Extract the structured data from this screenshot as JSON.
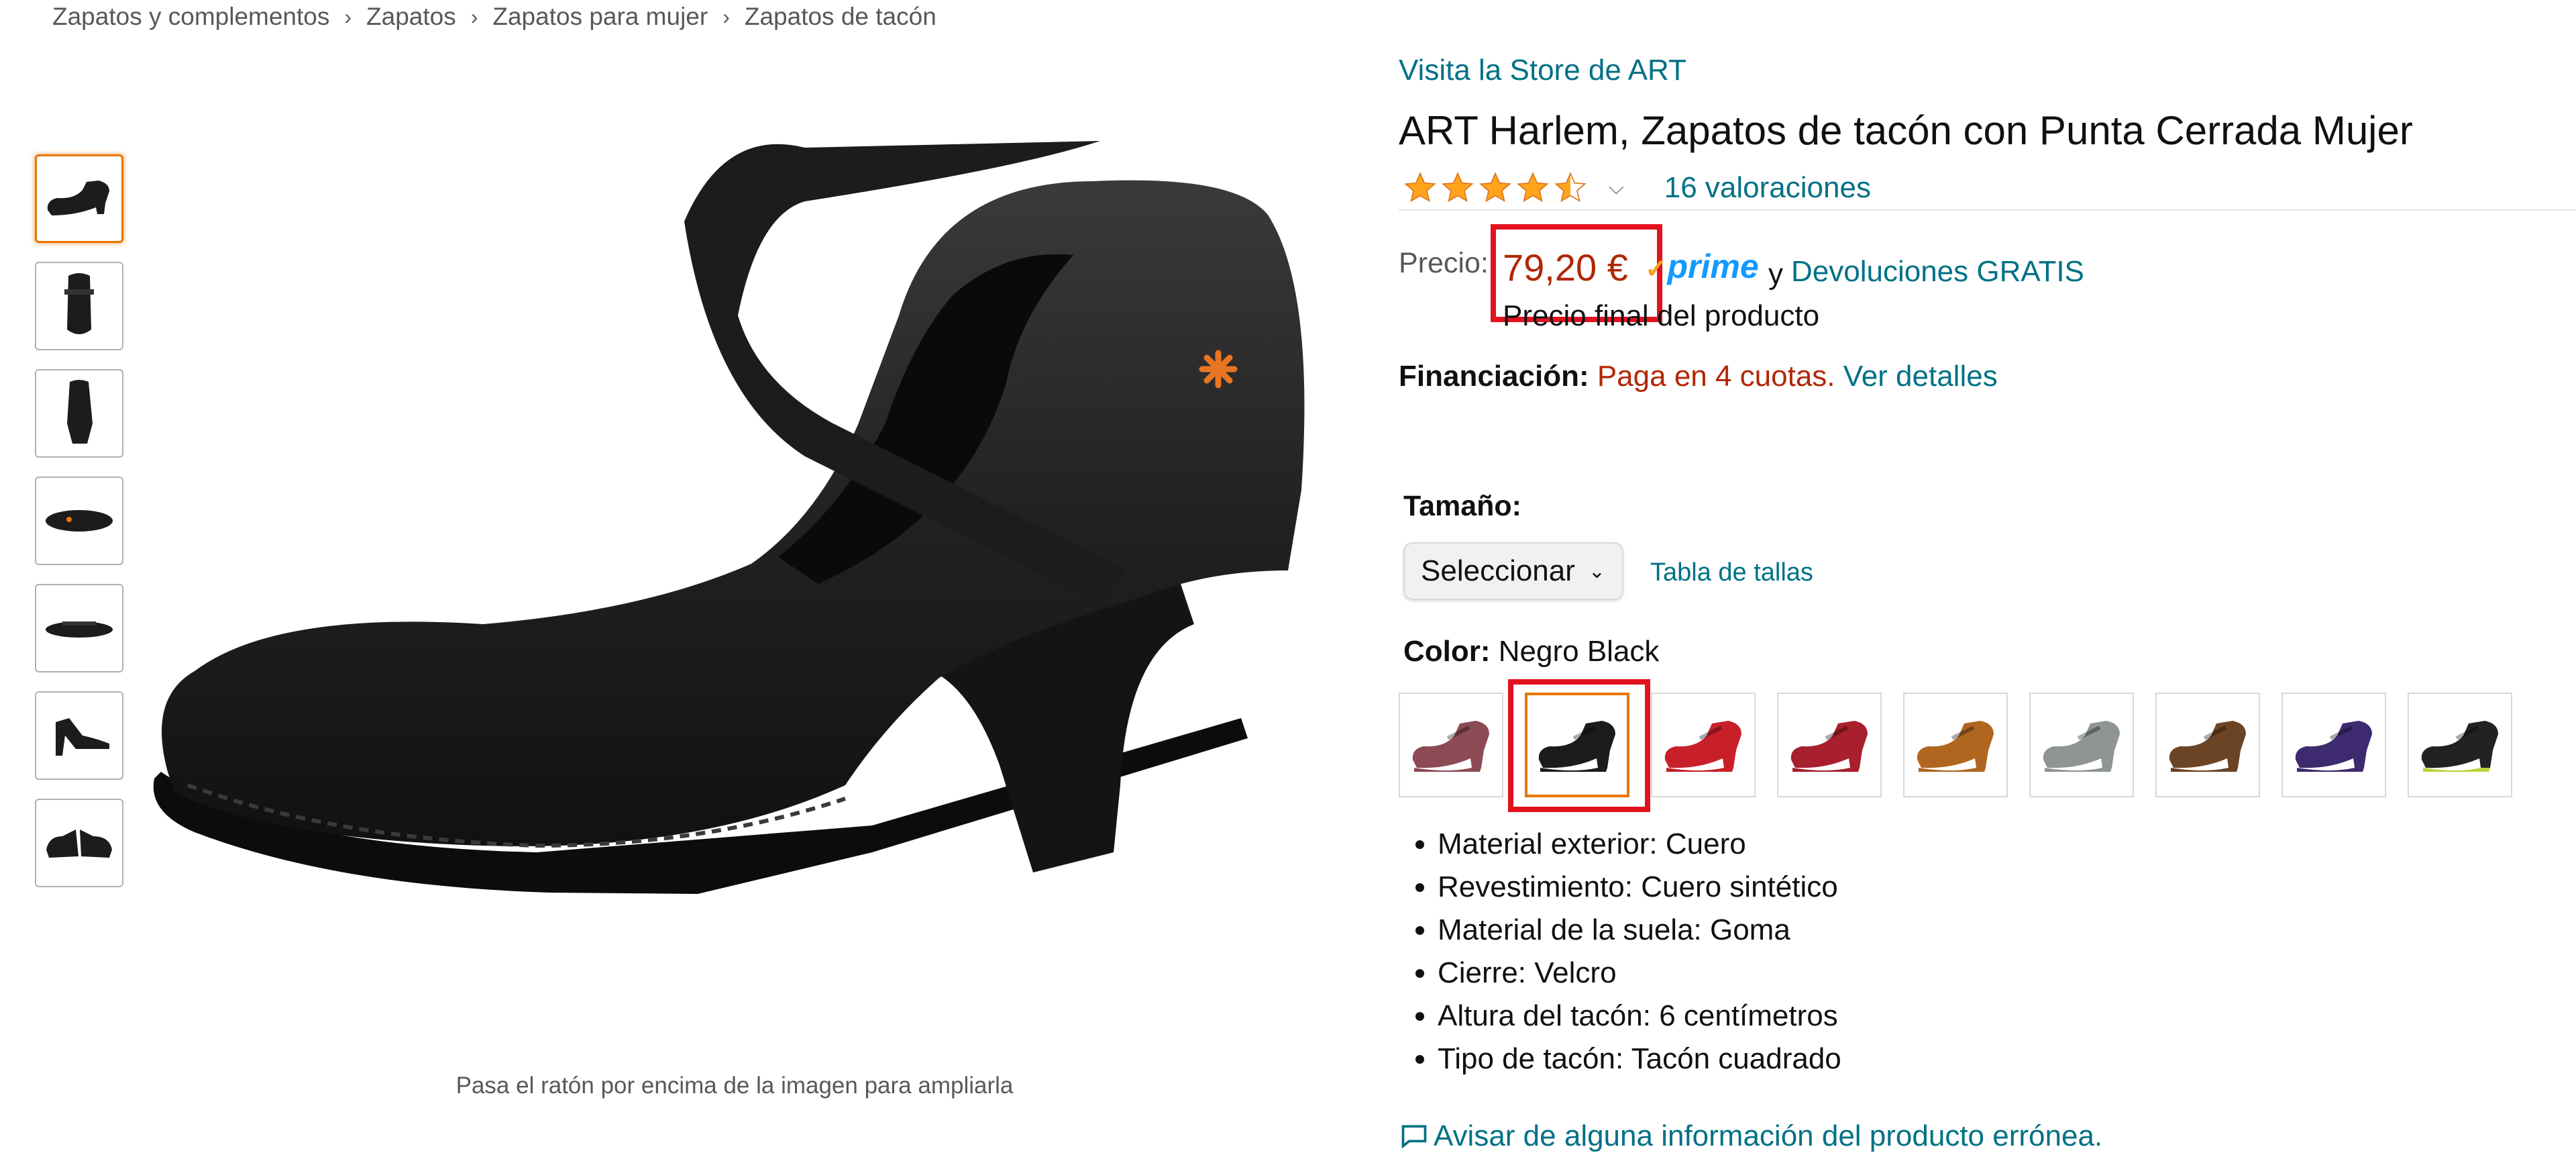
{
  "breadcrumb": [
    "Zapatos y complementos",
    "Zapatos",
    "Zapatos para mujer",
    "Zapatos de tacón"
  ],
  "gallery": {
    "hover_hint": "Pasa el ratón por encima de la imagen para ampliarla",
    "thumbnail_count": 7,
    "selected_index": 0
  },
  "product": {
    "store_link": "Visita la Store de ART",
    "title": "ART Harlem, Zapatos de tacón con Punta Cerrada Mujer",
    "rating_stars": 4.5,
    "ratings_count_text": "16 valoraciones",
    "price_label": "Precio:",
    "price": "79,20 €",
    "prime_label": "prime",
    "conjunction": "y",
    "returns_link": "Devoluciones GRATIS",
    "price_note": "Precio final del producto",
    "financing_label": "Financiación:",
    "financing_text": "Paga en 4 cuotas.",
    "financing_link": "Ver detalles"
  },
  "size": {
    "label": "Tamaño:",
    "selected": "Seleccionar",
    "chart_link": "Tabla de tallas"
  },
  "color": {
    "label": "Color:",
    "selected_name": "Negro Black",
    "selected_index": 1,
    "swatches": [
      {
        "name": "mauve",
        "hex": "#8c4a55"
      },
      {
        "name": "black",
        "hex": "#1c1c1c"
      },
      {
        "name": "red",
        "hex": "#c8202a"
      },
      {
        "name": "dark-red",
        "hex": "#a81f2d"
      },
      {
        "name": "tan",
        "hex": "#b0661f"
      },
      {
        "name": "grey",
        "hex": "#8e9593"
      },
      {
        "name": "brown",
        "hex": "#6b4426"
      },
      {
        "name": "purple",
        "hex": "#3e2a6e"
      },
      {
        "name": "black-lime",
        "hex": "#222222",
        "accent": "#b8d43a"
      }
    ]
  },
  "features": [
    "Material exterior: Cuero",
    "Revestimiento: Cuero sintético",
    "Material de la suela: Goma",
    "Cierre: Velcro",
    "Altura del tacón: 6 centímetros",
    "Tipo de tacón: Tacón cuadrado"
  ],
  "report_link": "Avisar de alguna información del producto errónea.",
  "colors": {
    "link": "#007185",
    "price": "#b12704",
    "highlight": "#e3121f",
    "star": "#ffa41c",
    "prime": "#1399ff"
  }
}
